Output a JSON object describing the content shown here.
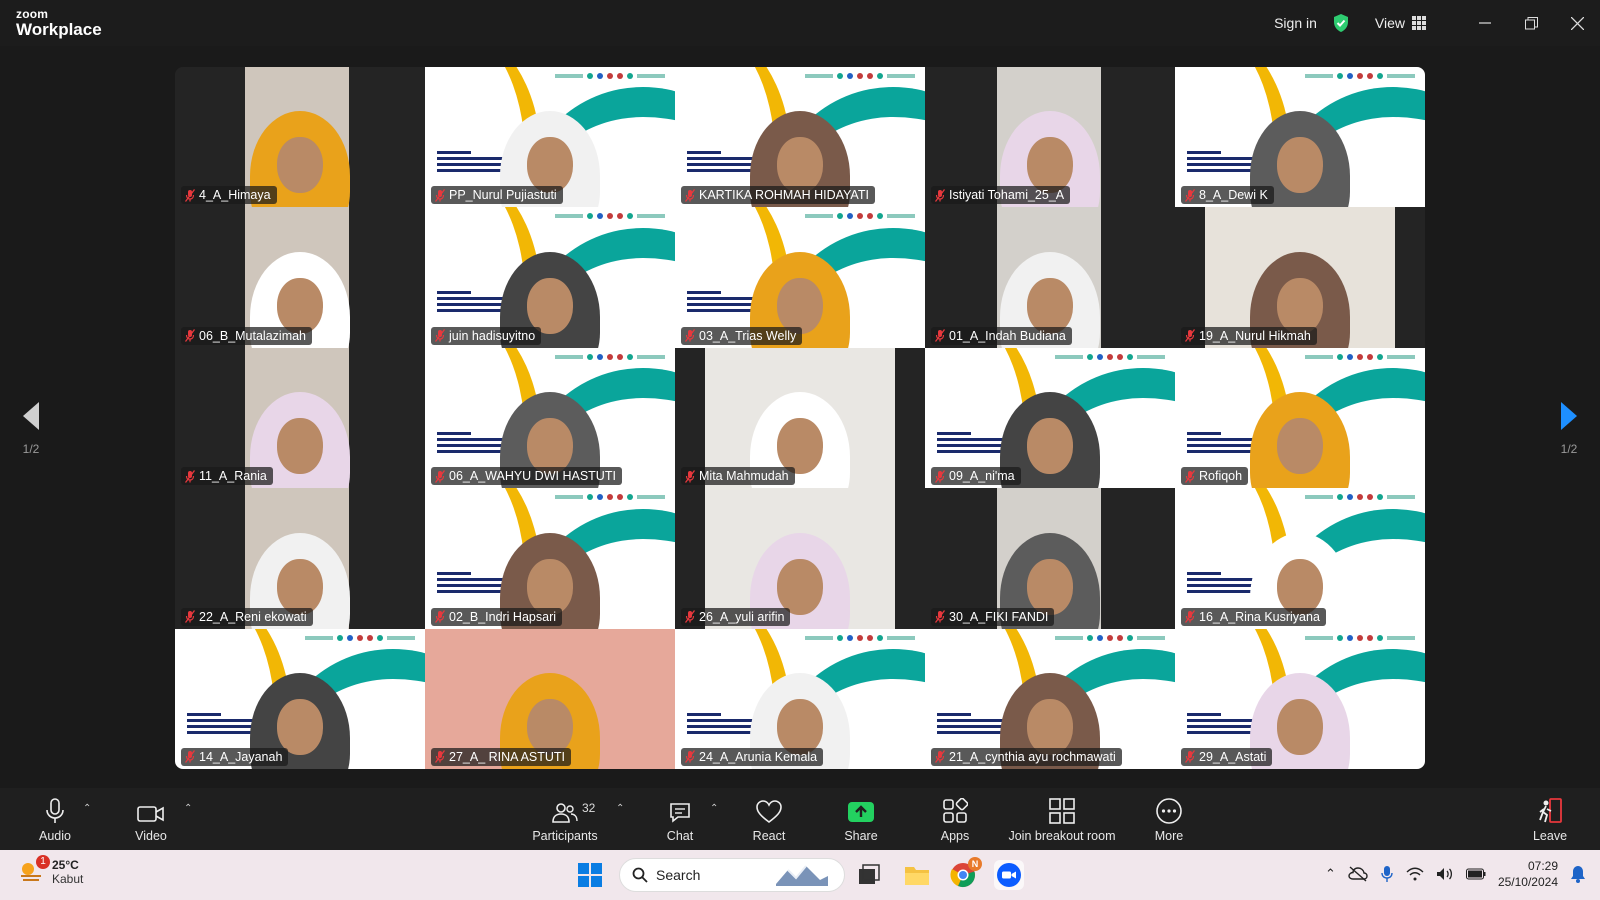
{
  "titlebar": {
    "logo_line1": "zoom",
    "logo_line2": "Workplace",
    "sign_in": "Sign in",
    "view": "View"
  },
  "participants_tiles": [
    {
      "name": "4_A_Himaya",
      "kind": "cam"
    },
    {
      "name": "PP_Nurul Pujiastuti",
      "kind": "slide",
      "active": true
    },
    {
      "name": "KARTIKA ROHMAH HIDAYATI",
      "kind": "slide"
    },
    {
      "name": "Istiyati Tohami_25_A",
      "kind": "cam"
    },
    {
      "name": "8_A_Dewi K",
      "kind": "slide"
    },
    {
      "name": "06_B_Mutalazimah",
      "kind": "cam"
    },
    {
      "name": "juin hadisuyitno",
      "kind": "slide"
    },
    {
      "name": "03_A_Trias Welly",
      "kind": "slide"
    },
    {
      "name": "01_A_Indah Budiana",
      "kind": "cam"
    },
    {
      "name": "19_A_Nurul Hikmah",
      "kind": "cam"
    },
    {
      "name": "11_A_Rania",
      "kind": "cam"
    },
    {
      "name": "06_A_WAHYU DWI HASTUTI",
      "kind": "slide"
    },
    {
      "name": "Mita Mahmudah",
      "kind": "cam"
    },
    {
      "name": "09_A_ni'ma",
      "kind": "slide"
    },
    {
      "name": "Rofiqoh",
      "kind": "slide"
    },
    {
      "name": "22_A_Reni ekowati",
      "kind": "cam"
    },
    {
      "name": "02_B_Indri Hapsari",
      "kind": "slide"
    },
    {
      "name": "26_A_yuli arifin",
      "kind": "cam"
    },
    {
      "name": "30_A_FIKI FANDI",
      "kind": "cam"
    },
    {
      "name": "16_A_Rina Kusriyana",
      "kind": "slide"
    },
    {
      "name": "14_A_Jayanah",
      "kind": "slide"
    },
    {
      "name": "27_A_ RINA ASTUTI",
      "kind": "cam"
    },
    {
      "name": "24_A_Arunia Kemala",
      "kind": "slide"
    },
    {
      "name": "21_A_cynthia ayu rochmawati",
      "kind": "slide"
    },
    {
      "name": "29_A_Astati",
      "kind": "slide"
    }
  ],
  "pager": {
    "left": "1/2",
    "right": "1/2"
  },
  "toolbar": {
    "audio": "Audio",
    "video": "Video",
    "participants": "Participants",
    "participant_count": "32",
    "chat": "Chat",
    "react": "React",
    "share": "Share",
    "apps": "Apps",
    "breakout": "Join breakout room",
    "more": "More",
    "leave": "Leave"
  },
  "taskbar": {
    "temperature": "25°C",
    "weather": "Kabut",
    "weather_badge": "1",
    "search": "Search",
    "chrome_badge": "N",
    "time": "07:29",
    "date": "25/10/2024"
  },
  "colors": {
    "accent_green": "#2ee47b",
    "share_green": "#23d160",
    "zoom_blue": "#0b5cff",
    "mic_muted_red": "#e8383d"
  }
}
